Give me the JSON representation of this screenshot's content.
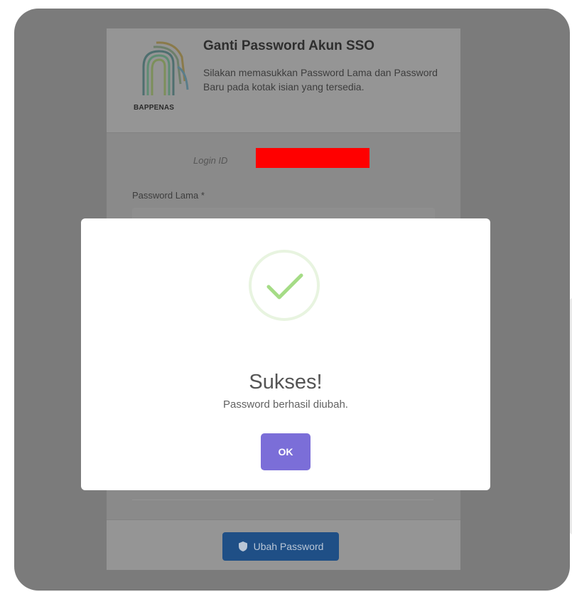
{
  "header": {
    "logo_text": "BAPPENAS",
    "title": "Ganti Password Akun SSO",
    "description": "Silakan memasukkan Password Lama dan Password Baru pada kotak isian yang tersedia."
  },
  "form": {
    "login_id_label": "Login ID",
    "password_lama_label": "Password Lama *",
    "submit_label": "Ubah Password",
    "submit_icon": "shield-icon"
  },
  "modal": {
    "icon": "checkmark-icon",
    "title": "Sukses!",
    "message": "Password berhasil diubah.",
    "ok_label": "OK"
  },
  "colors": {
    "overlay": "#7b7b7b",
    "ok_button": "#7b6ed8",
    "success_check": "#a5dc86",
    "submit_button": "#1f4f86",
    "redaction": "#ff0000"
  }
}
